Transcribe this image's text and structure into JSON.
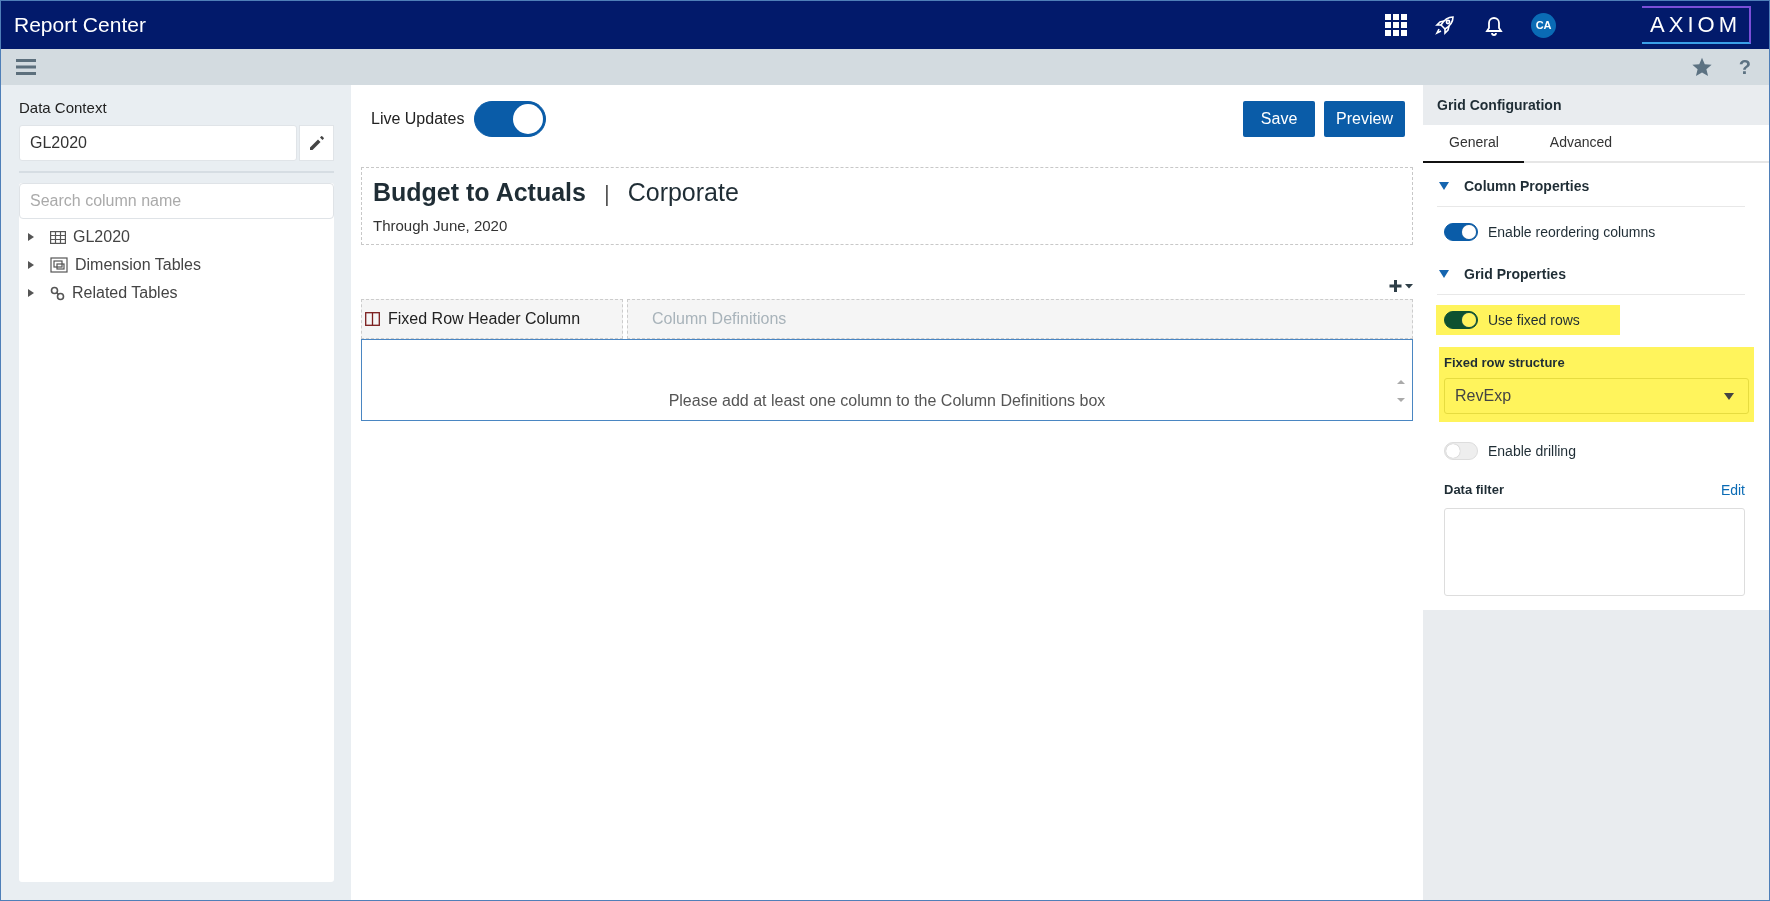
{
  "app_bar": {
    "title": "Report Center",
    "avatar": "CA",
    "logo": "AXIOM",
    "help": "?"
  },
  "left_panel": {
    "label": "Data Context",
    "context_value": "GL2020",
    "search": {
      "placeholder": "Search column name"
    },
    "tree": [
      {
        "label": "GL2020",
        "kind": "table",
        "expanded": false
      },
      {
        "label": "Dimension Tables",
        "kind": "dimension",
        "expanded": false
      },
      {
        "label": "Related Tables",
        "kind": "related",
        "expanded": false
      }
    ]
  },
  "editor": {
    "live_updates": {
      "label": "Live Updates",
      "on": true
    },
    "buttons": [
      "Save",
      "Preview"
    ],
    "report": {
      "title": "Budget to Actuals",
      "separator": "|",
      "subtitle": "Corporate",
      "period": "Through June, 2020"
    },
    "fixed_header": "Fixed Row Header Column",
    "column_definitions": {
      "placeholder": "Column Definitions"
    },
    "empty_message": "Please add at least one column to the Column Definitions box"
  },
  "config_panel": {
    "title": "Grid Configuration",
    "tabs": [
      {
        "label": "General",
        "selected": true
      },
      {
        "label": "Advanced",
        "selected": false
      }
    ],
    "sections": [
      {
        "title": "Column Properties",
        "expanded": true,
        "items": [
          {
            "kind": "toggle",
            "label": "Enable reordering columns",
            "on": true,
            "highlighted": false
          }
        ]
      },
      {
        "title": "Grid Properties",
        "expanded": true,
        "items": [
          {
            "kind": "toggle",
            "label": "Use fixed rows",
            "on": true,
            "highlighted": true
          },
          {
            "kind": "select",
            "label": "Fixed row structure",
            "value": "RevExp",
            "highlighted": true
          },
          {
            "kind": "toggle",
            "label": "Enable drilling",
            "on": false,
            "highlighted": false
          },
          {
            "kind": "filter",
            "label": "Data filter",
            "action": "Edit"
          }
        ]
      }
    ]
  }
}
